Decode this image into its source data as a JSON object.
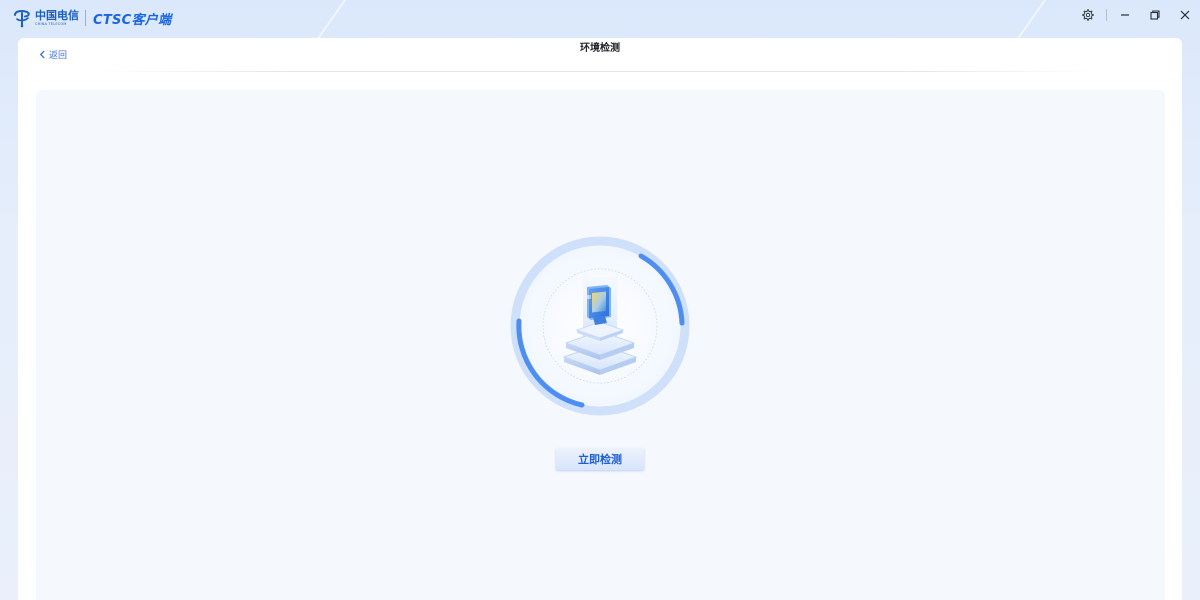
{
  "brand": {
    "cn_name": "中国电信",
    "en_name": "CHINA TELECOM",
    "app_name": "CTSC客户端",
    "logo_icon": "china-telecom-logo-icon"
  },
  "window": {
    "settings_icon": "gear-icon",
    "minimize_icon": "minimize-icon",
    "restore_icon": "restore-icon",
    "close_icon": "close-icon"
  },
  "header": {
    "back_label": "返回",
    "title": "环境检测"
  },
  "main": {
    "detect_button_label": "立即检测",
    "illustration_icon": "environment-detection-icon"
  },
  "colors": {
    "accent": "#1a66e0",
    "ring_arc": "#4d8ef0",
    "ring_light": "#cfe0fb",
    "content_bg": "#f5f8fd"
  }
}
